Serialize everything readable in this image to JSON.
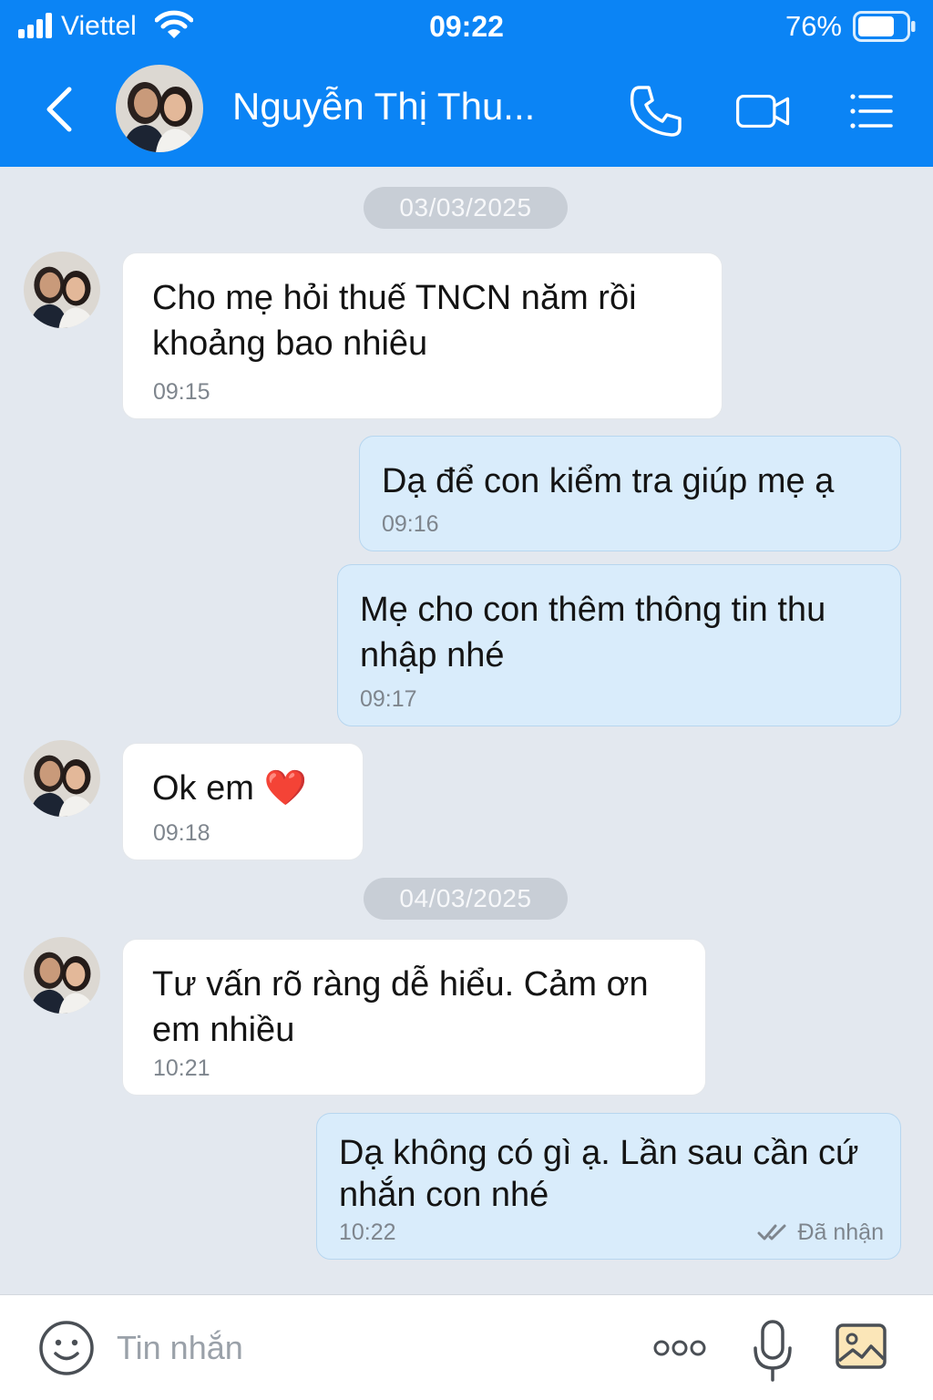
{
  "status_bar": {
    "carrier": "Viettel",
    "time": "09:22",
    "battery_percent": "76%",
    "battery_level": 0.76
  },
  "header": {
    "contact_name": "Nguyễn Thị Thu...",
    "icons": [
      "back-icon",
      "phone-icon",
      "video-camera-icon",
      "menu-icon"
    ]
  },
  "colors": {
    "header": "#0b84f5",
    "chat_background": "#e3e8ef",
    "incoming_bubble": "#ffffff",
    "outgoing_bubble": "#d9ecfb",
    "timestamp": "#7e858d"
  },
  "chat": {
    "dates": [
      "03/03/2025",
      "04/03/2025"
    ],
    "messages": [
      {
        "direction": "incoming",
        "text": "Cho mẹ hỏi thuế TNCN năm rồi khoảng bao nhiêu",
        "time": "09:15"
      },
      {
        "direction": "outgoing",
        "text": "Dạ để con kiểm tra giúp mẹ ạ",
        "time": "09:16"
      },
      {
        "direction": "outgoing",
        "text": "Mẹ cho con thêm thông tin thu nhập nhé",
        "time": "09:17"
      },
      {
        "direction": "incoming",
        "text": "Ok em ❤️",
        "time": "09:18"
      },
      {
        "direction": "incoming",
        "text": "Tư vấn rõ ràng dễ hiểu. Cảm ơn em nhiều",
        "time": "10:21"
      },
      {
        "direction": "outgoing",
        "text": "Dạ không có gì ạ. Lần sau cần cứ nhắn con nhé",
        "time": "10:22",
        "status": "Đã nhận"
      }
    ]
  },
  "input_bar": {
    "placeholder": "Tin nhắn",
    "value": "",
    "icons": [
      "emoji-icon",
      "more-icon",
      "microphone-icon",
      "image-icon"
    ]
  }
}
